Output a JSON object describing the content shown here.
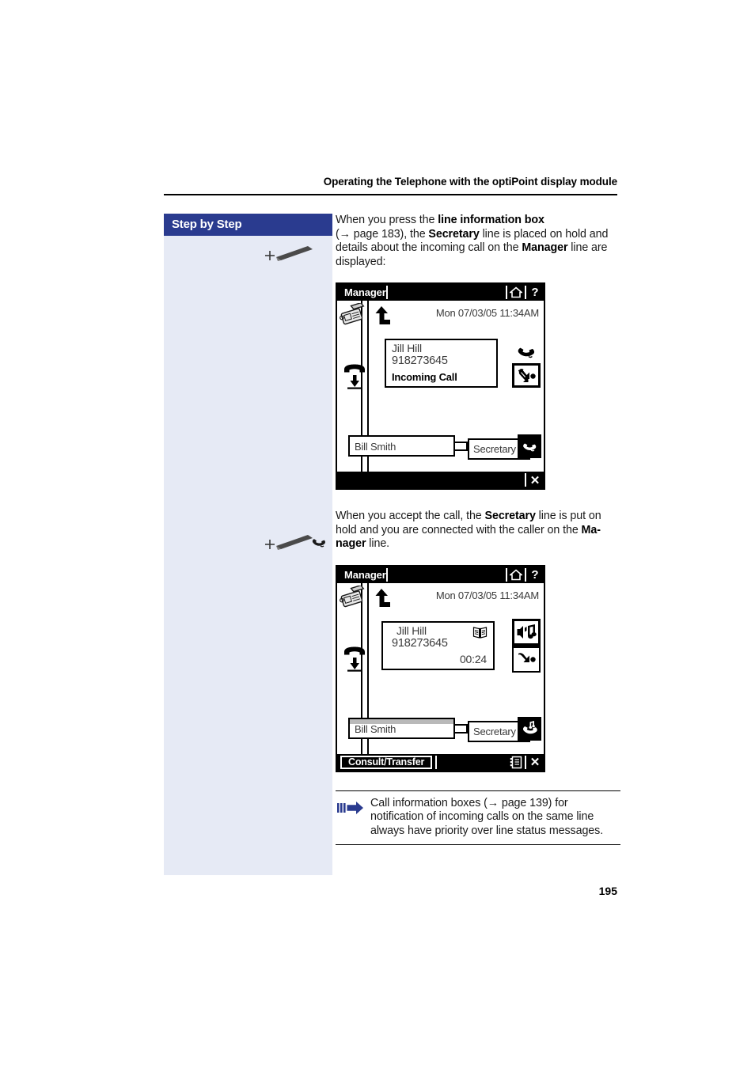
{
  "page": {
    "header_title": "Operating the Telephone with the optiPoint display module",
    "number": "195"
  },
  "sidebar": {
    "title": "Step by Step"
  },
  "steps": [
    {
      "gutter_icon": "stylus-icon",
      "text_parts": [
        {
          "t": "When you press the ",
          "b": false
        },
        {
          "t": "line information box",
          "b": true
        },
        {
          "t": "\n(→ page 183), the ",
          "b": false
        },
        {
          "t": "Secretary",
          "b": true
        },
        {
          "t": " line is placed on hold and details about the incoming call on the ",
          "b": false
        },
        {
          "t": "Manager",
          "b": true
        },
        {
          "t": " line are displayed:",
          "b": false
        }
      ]
    },
    {
      "gutter_icon": "handset-icon",
      "text_parts": [
        {
          "t": "When you accept the call, the ",
          "b": false
        },
        {
          "t": "Secretary",
          "b": true
        },
        {
          "t": " line is put on hold and you are connected with the caller on the ",
          "b": false
        },
        {
          "t": "Ma-nager",
          "b": true
        },
        {
          "t": " line.",
          "b": false
        }
      ]
    }
  ],
  "screen1": {
    "title": "Manager",
    "home_icon": "home-icon",
    "help_label": "?",
    "datetime": "Mon 07/03/05 11:34AM",
    "phoneset_icon": "desk-phone-icon",
    "incoming_arrow_icon": "incoming-call-arrow-icon",
    "hold_icon": "handset-hold-down-icon",
    "callbox": {
      "name": "Jill Hill",
      "number": "918273645",
      "status": "Incoming Call",
      "duration": "",
      "directory_icon": ""
    },
    "rkeys": [
      {
        "icon": "answer-handset-icon",
        "selected": false
      },
      {
        "icon": "forward-call-icon",
        "selected": true
      }
    ],
    "lines": {
      "primary_label": "Bill Smith",
      "primary_held": false,
      "secondary_label": "Secretary",
      "line_icon": "handset-icon"
    },
    "footer": {
      "softkey_label": "",
      "list_icon": "",
      "close_label": "✕"
    }
  },
  "screen2": {
    "title": "Manager",
    "home_icon": "home-icon",
    "help_label": "?",
    "datetime": "Mon 07/03/05 11:34AM",
    "phoneset_icon": "desk-phone-icon",
    "incoming_arrow_icon": "incoming-call-arrow-icon",
    "hold_icon": "handset-hold-down-icon",
    "callbox": {
      "name": "Jill Hill",
      "number": "918273645",
      "status": "",
      "duration": "00:24",
      "directory_icon": "phone-book-icon"
    },
    "rkeys": [
      {
        "icon": "hold-music-icon",
        "selected": false
      },
      {
        "icon": "forward-call-icon",
        "selected": false
      }
    ],
    "lines": {
      "primary_label": "Bill Smith",
      "primary_held": true,
      "secondary_label": "Secretary",
      "line_icon": "handset-music-icon"
    },
    "footer": {
      "softkey_label": "Consult/Transfer",
      "list_icon": "call-list-icon",
      "close_label": "✕"
    }
  },
  "note": {
    "arrow_icon": "note-arrow-icon",
    "text": "Call information boxes (→ page 139) for notification of incoming calls on the same line always have priority over line status messages."
  },
  "colors": {
    "sidebar_header_bg": "#2a3b8f",
    "sidebar_bg": "#e6eaf5",
    "note_arrow": "#2a3b8f",
    "text": "#1a1a1a"
  }
}
